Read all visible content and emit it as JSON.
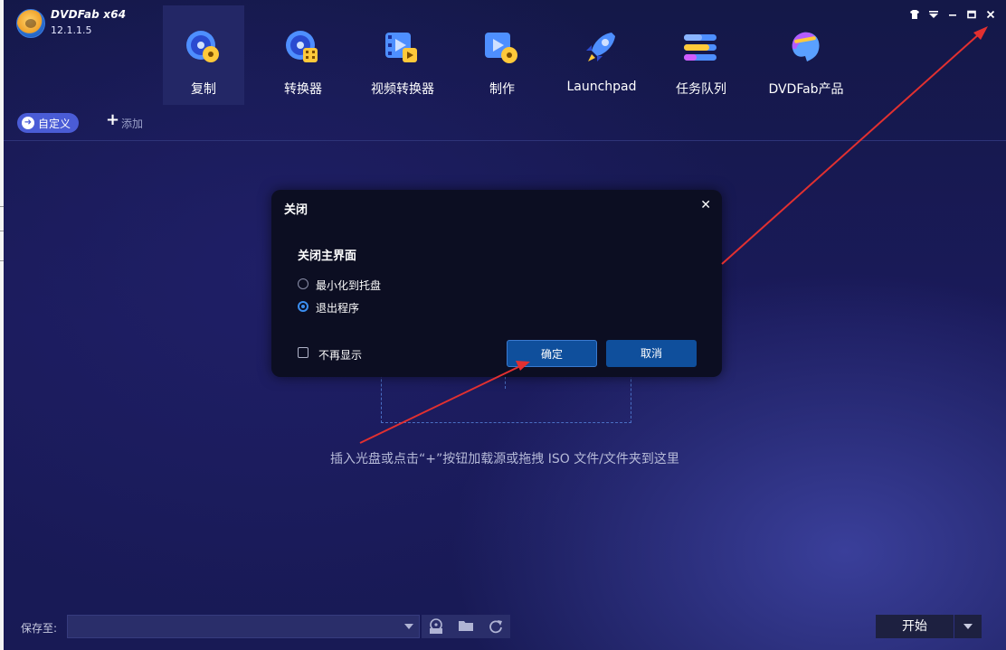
{
  "app": {
    "brand": "DVDFab x64",
    "version": "12.1.1.5"
  },
  "nav": {
    "items": [
      {
        "label": "复制",
        "icon": "disc-copy-icon"
      },
      {
        "label": "转换器",
        "icon": "disc-ripper-icon"
      },
      {
        "label": "视频转换器",
        "icon": "video-converter-icon"
      },
      {
        "label": "制作",
        "icon": "creator-icon"
      },
      {
        "label": "Launchpad",
        "icon": "rocket-icon"
      },
      {
        "label": "任务队列",
        "icon": "task-queue-icon"
      },
      {
        "label": "DVDFab产品",
        "icon": "products-icon"
      }
    ],
    "active_index": 0
  },
  "window_controls": {
    "icons": [
      "skin-icon",
      "menu-icon",
      "minimize-icon",
      "maximize-icon",
      "close-icon"
    ]
  },
  "toolbar": {
    "mode_label": "自定义",
    "add_label": "添加"
  },
  "main": {
    "hint": "插入光盘或点击“+”按钮加载源或拖拽 ISO 文件/文件夹到这里"
  },
  "dialog": {
    "title": "关闭",
    "heading": "关闭主界面",
    "options": [
      {
        "label": "最小化到托盘",
        "checked": false
      },
      {
        "label": "退出程序",
        "checked": true
      }
    ],
    "dont_show_label": "不再显示",
    "ok_label": "确定",
    "cancel_label": "取消"
  },
  "bottom": {
    "save_label": "保存至:",
    "save_value": "",
    "tools": [
      "iso-icon",
      "folder-icon",
      "refresh-icon"
    ],
    "start_label": "开始"
  },
  "colors": {
    "accent": "#3b8ef0",
    "button": "#0f4f9c",
    "pill": "#4a5cd6",
    "arrow": "#e23030"
  }
}
